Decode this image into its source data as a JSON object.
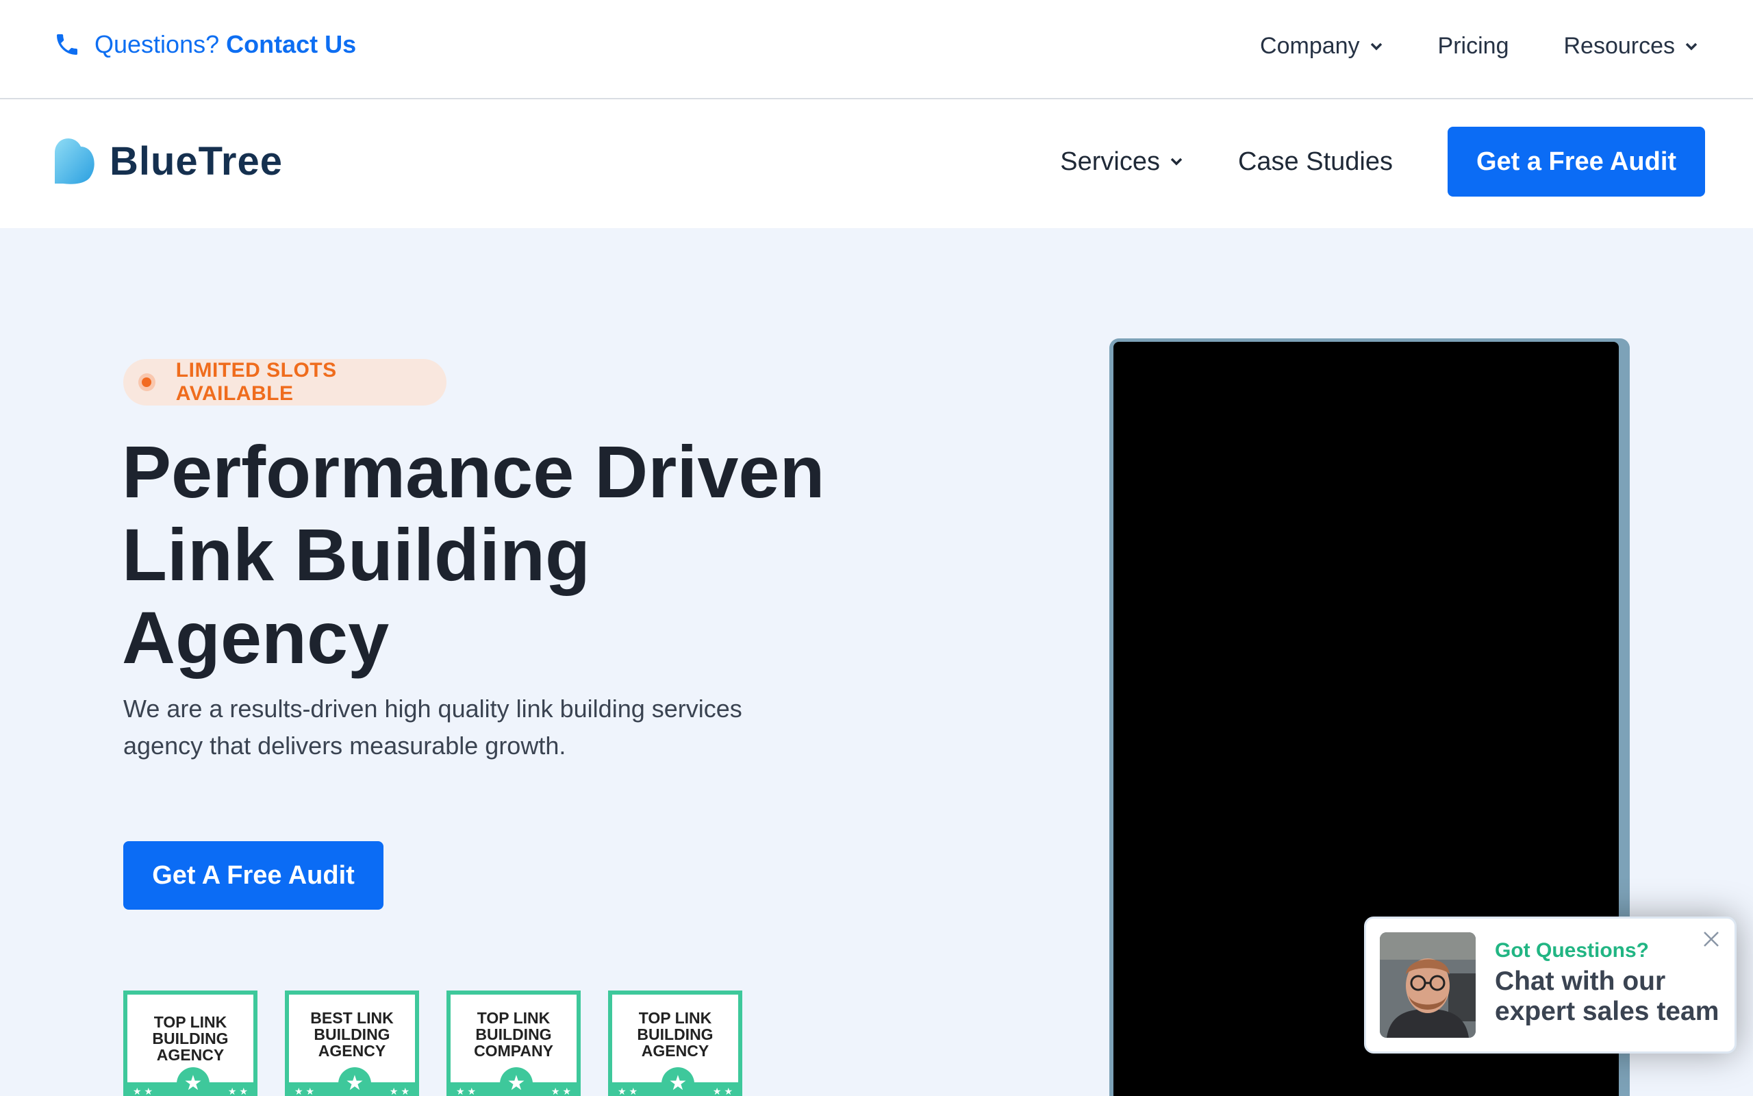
{
  "topbar": {
    "contact_prefix": "Questions?",
    "contact_link": "Contact Us",
    "phone_icon": "phone-icon",
    "nav": [
      {
        "label": "Company",
        "dropdown": true
      },
      {
        "label": "Pricing",
        "dropdown": false
      },
      {
        "label": "Resources",
        "dropdown": true
      }
    ]
  },
  "header": {
    "logo_text": "BlueTree",
    "nav": [
      {
        "label": "Services",
        "dropdown": true
      },
      {
        "label": "Case Studies",
        "dropdown": false
      }
    ],
    "cta": "Get a Free Audit"
  },
  "hero": {
    "badge": "LIMITED SLOTS AVAILABLE",
    "headline_lines": [
      "Performance Driven",
      "Link Building",
      "Agency"
    ],
    "subtext_lines": [
      "We are a results-driven high quality link building services",
      "agency that delivers measurable growth."
    ],
    "cta": "Get A Free Audit",
    "awards": [
      {
        "lines": [
          "TOP LINK",
          "BUILDING",
          "AGENCY"
        ]
      },
      {
        "lines": [
          "BEST LINK",
          "BUILDING",
          "AGENCY"
        ]
      },
      {
        "lines": [
          "TOP LINK",
          "BUILDING",
          "COMPANY"
        ]
      },
      {
        "lines": [
          "TOP LINK",
          "BUILDING",
          "AGENCY"
        ]
      }
    ]
  },
  "chat": {
    "title": "Got Questions?",
    "message_lines": [
      "Chat with our",
      "expert sales team"
    ]
  },
  "colors": {
    "brand_blue": "#0b6cf5",
    "badge_orange": "#ef6c1d",
    "award_green": "#3ec89b",
    "chat_green": "#21b583",
    "hero_bg": "#eff4fc"
  }
}
